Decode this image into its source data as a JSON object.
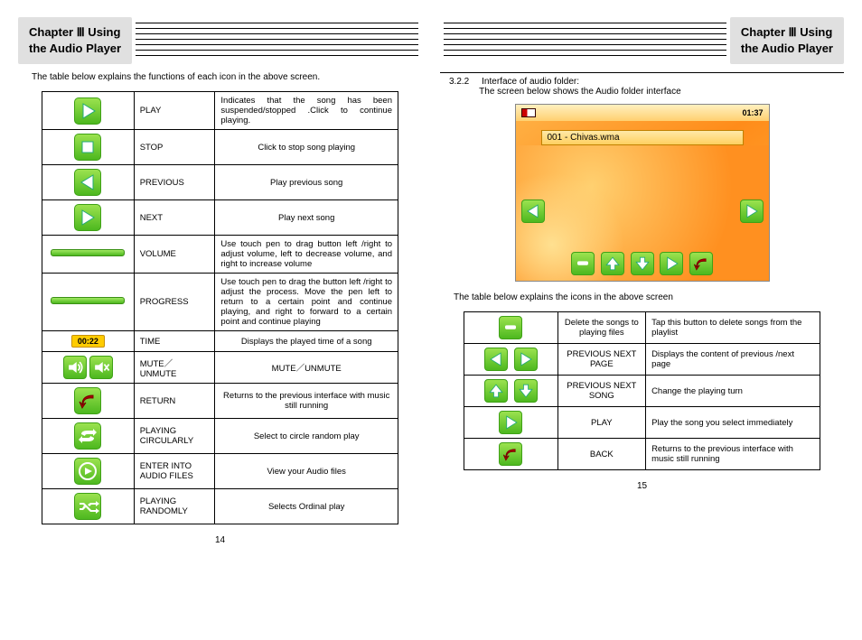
{
  "chapter": {
    "label": "Chapter Ⅲ   Using\nthe Audio Player"
  },
  "left": {
    "intro": "The table below explains the functions of each icon in the above screen.",
    "rows": [
      {
        "name": "PLAY",
        "desc": "Indicates that the song has been suspended/stopped .Click to continue playing."
      },
      {
        "name": "STOP",
        "desc": "Click to stop song playing"
      },
      {
        "name": "PREVIOUS",
        "desc": "Play previous song"
      },
      {
        "name": "NEXT",
        "desc": "Play next song"
      },
      {
        "name": "VOLUME",
        "desc": "Use touch pen to drag button left /right to adjust volume, left to decrease volume, and right to increase volume"
      },
      {
        "name": "PROGRESS",
        "desc": "Use touch pen to drag the button left /right to adjust the process. Move the pen left to  return to a certain point and continue playing, and right to forward to a certain point and continue playing"
      },
      {
        "name": "TIME",
        "desc": "Displays the played time of a song"
      },
      {
        "name": "MUTE／UNMUTE",
        "desc": "MUTE／UNMUTE"
      },
      {
        "name": "RETURN",
        "desc": "Returns to the previous interface with music still running"
      },
      {
        "name": "PLAYING CIRCULARLY",
        "desc": "Select to circle random play"
      },
      {
        "name": "ENTER INTO AUDIO FILES",
        "desc": "View your Audio files"
      },
      {
        "name": "PLAYING RANDOMLY",
        "desc": "Selects Ordinal play"
      }
    ],
    "time_chip": "00:22",
    "pagenum": "14"
  },
  "right": {
    "section_num": "3.2.2",
    "section_title": "Interface of audio folder:",
    "section_sub": "The screen below shows the Audio folder interface",
    "clock": "01:37",
    "file": "001 - Chivas.wma",
    "intro": "The table below explains the icons in the above screen",
    "rows": [
      {
        "name": "Delete the songs to playing files",
        "desc": "Tap this button to delete songs from the playlist"
      },
      {
        "name": "PREVIOUS NEXT PAGE",
        "desc": "Displays the content of previous /next page"
      },
      {
        "name": "PREVIOUS NEXT SONG",
        "desc": "Change  the  playing  turn"
      },
      {
        "name": "PLAY",
        "desc": "Play the song you select immediately"
      },
      {
        "name": "BACK",
        "desc": "Returns to the previous interface with music still running"
      }
    ],
    "pagenum": "15"
  }
}
